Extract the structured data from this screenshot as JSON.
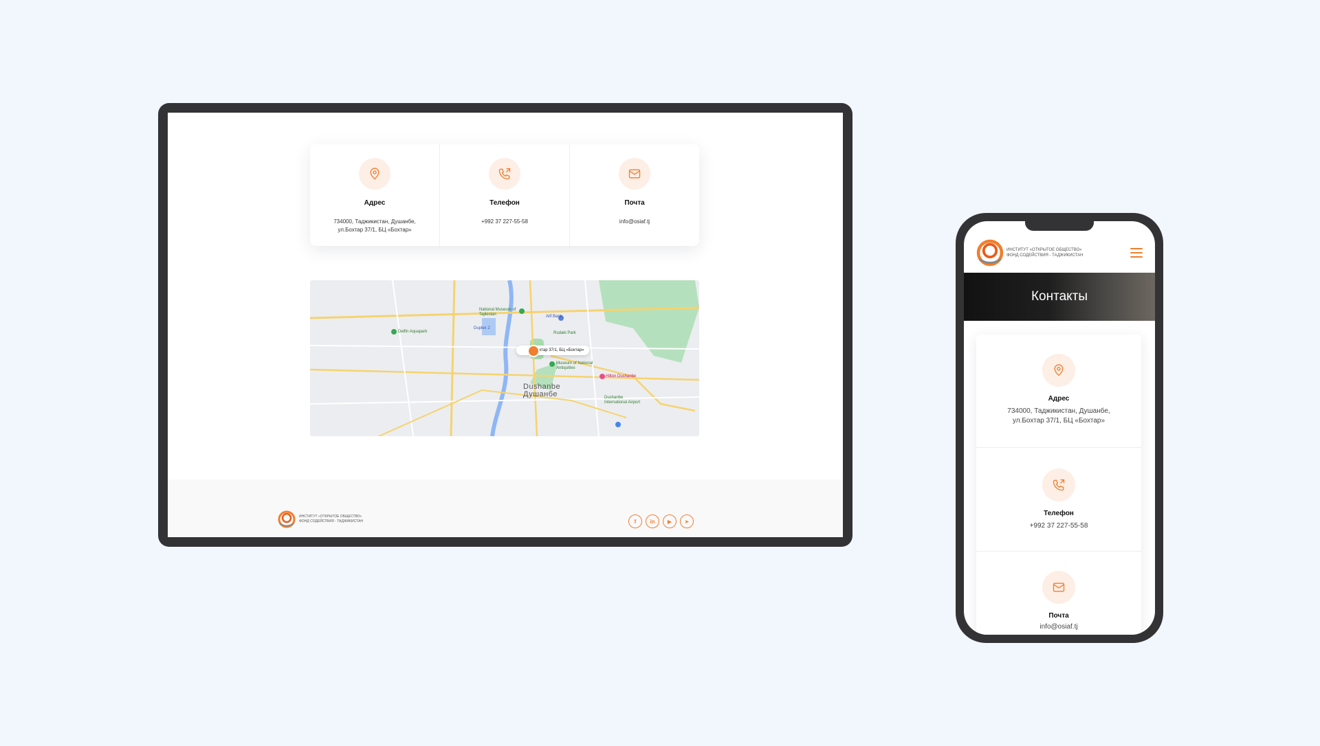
{
  "brand": {
    "line1": "Институт «Открытое общество»",
    "line2": "Фонд содействия - Таджикистан"
  },
  "contacts": {
    "address": {
      "title": "Адрес",
      "text": "734000, Таджикистан, Душанбе, ул.Бохтар 37/1, БЦ «Бохтар»",
      "icon": "location-pin-icon"
    },
    "phone": {
      "title": "Телефон",
      "text": "+992 37 227-55-58",
      "icon": "phone-icon"
    },
    "email": {
      "title": "Почта",
      "text": "info@osiaf.tj",
      "icon": "mail-icon"
    }
  },
  "map": {
    "pin_label": "ул.Бохтар 37/1, БЦ «Бохтар»",
    "city_en": "Dushanbe",
    "city_ru": "Душанбе",
    "places": {
      "aquapark": "Delfin Aquapark",
      "museum": "National Museum of Tajikistan",
      "bank": "Alif Bank",
      "park": "Rudaki Park",
      "antiquities": "Museum of National Antiquities",
      "hilton": "Hilton Dushanbe",
      "airport": "Dushanbe International Airport",
      "duplex": "Duplex 2"
    },
    "colors": {
      "road": "#f5d36e",
      "river": "#8fb6f5",
      "park": "#a8dcb0"
    }
  },
  "footer": {
    "socials": [
      {
        "label": "f",
        "icon": "facebook-icon"
      },
      {
        "label": "in",
        "icon": "linkedin-icon"
      },
      {
        "label": "▶",
        "icon": "youtube-icon"
      },
      {
        "label": "➤",
        "icon": "telegram-icon"
      }
    ]
  },
  "mobile": {
    "page_title": "Контакты",
    "menu_icon": "hamburger-icon"
  },
  "theme": {
    "accent": "#f07f2e",
    "icon_bg": "#fdeee6",
    "background": "#f2f6fd",
    "frame": "#333336"
  }
}
